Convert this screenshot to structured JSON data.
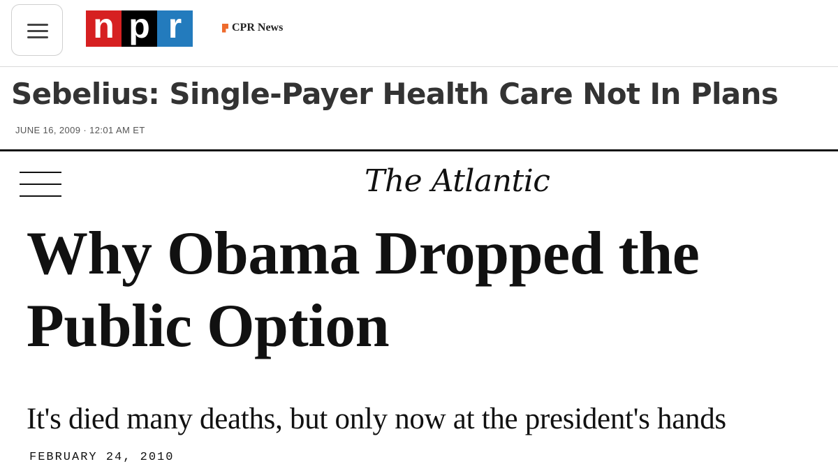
{
  "npr": {
    "menu_icon": "hamburger-menu-icon",
    "logo_letters": [
      "n",
      "p",
      "r"
    ],
    "logo_colors": [
      "#d62021",
      "#000000",
      "#237bbd"
    ],
    "partner": "CPR News",
    "partner_icon": "cpr-flag-icon",
    "headline": "Sebelius: Single-Payer Health Care Not In Plans",
    "date": "JUNE 16, 2009 · 12:01 AM ET"
  },
  "atlantic": {
    "menu_icon": "hamburger-menu-icon",
    "logo": "The Atlantic",
    "headline_line1": "Why Obama Dropped the",
    "headline_line2": "Public Option",
    "subtitle": "It's died many deaths, but only now at the president's hands",
    "date": "FEBRUARY 24, 2010"
  }
}
